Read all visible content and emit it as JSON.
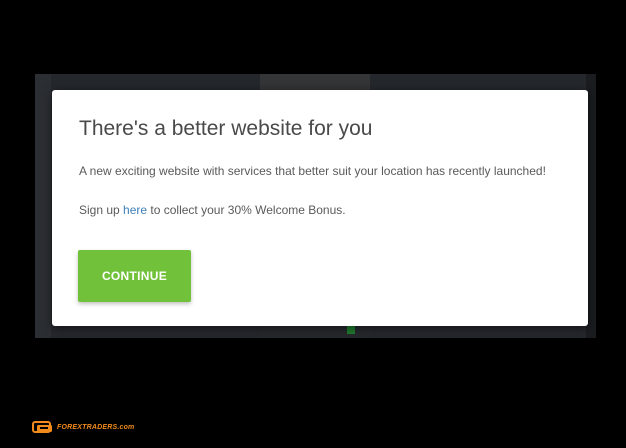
{
  "modal": {
    "title": "There's a better website for you",
    "message": "A new exciting website with services that better suit your location has recently launched!",
    "signup_prefix": "Sign up ",
    "signup_link": "here",
    "signup_suffix": " to collect your 30% Welcome Bonus.",
    "continue_label": "CONTINUE"
  },
  "watermark": {
    "text": "FOREXTRADERS.com"
  },
  "colors": {
    "accent_button": "#71c23a",
    "link": "#3d7fb8",
    "watermark": "#f08a1c",
    "overlay": "#000000"
  },
  "icons": {
    "watermark_logo": "forextraders-logo-icon"
  }
}
